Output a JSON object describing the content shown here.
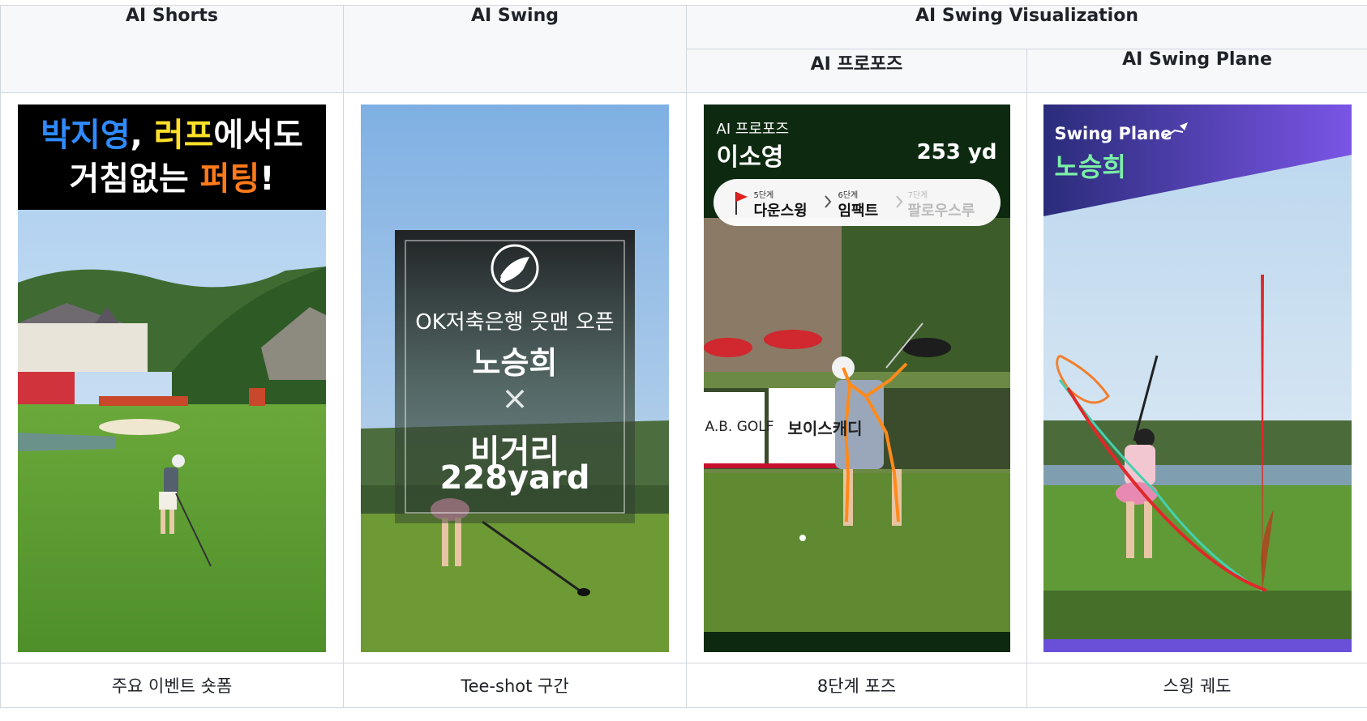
{
  "headers": {
    "ai_shorts": "AI Shorts",
    "ai_swing": "AI Swing",
    "ai_swing_visualization": "AI Swing Visualization",
    "ai_propose": "AI 프로포즈",
    "ai_swing_plane": "AI Swing Plane"
  },
  "captions": {
    "shorts": "주요 이벤트 숏폼",
    "swing": "Tee-shot 구간",
    "propose": "8단계 포즈",
    "plane": "스윙 궤도"
  },
  "shorts_panel": {
    "name_text": "박지영",
    "comma": ",",
    "rough_text": "러프",
    "line1_tail": "에서도",
    "line2_head": "거침없는",
    "putting_text": "퍼팅",
    "exclaim": "!",
    "colors": {
      "name": "#2f8bff",
      "rough": "#ffe02a",
      "putting": "#ff7a1a",
      "white": "#ffffff"
    }
  },
  "swing_panel": {
    "tournament": "OK저축은행 읏맨 오픈",
    "player": "노승희",
    "times_symbol": "×",
    "metric_label": "비거리",
    "metric_value": "228yard",
    "logo_icon": "golfer-logo-icon"
  },
  "propose_panel": {
    "label": "AI 프로포즈",
    "player": "이소영",
    "distance": "253 yd",
    "stages": [
      {
        "step": "5단계",
        "name": "다운스윙"
      },
      {
        "step": "6단계",
        "name": "임팩트"
      },
      {
        "step": "7단계",
        "name": "팔로우스루"
      }
    ],
    "banner_left": "A.B. GOLF",
    "banner_right": "보이스캐디",
    "flag_icon": "red-flag-icon",
    "chevron_icon": "chevron-right-icon"
  },
  "plane_panel": {
    "title": "Swing Plane",
    "player": "노승희",
    "title_icon": "swing-arrow-icon"
  }
}
